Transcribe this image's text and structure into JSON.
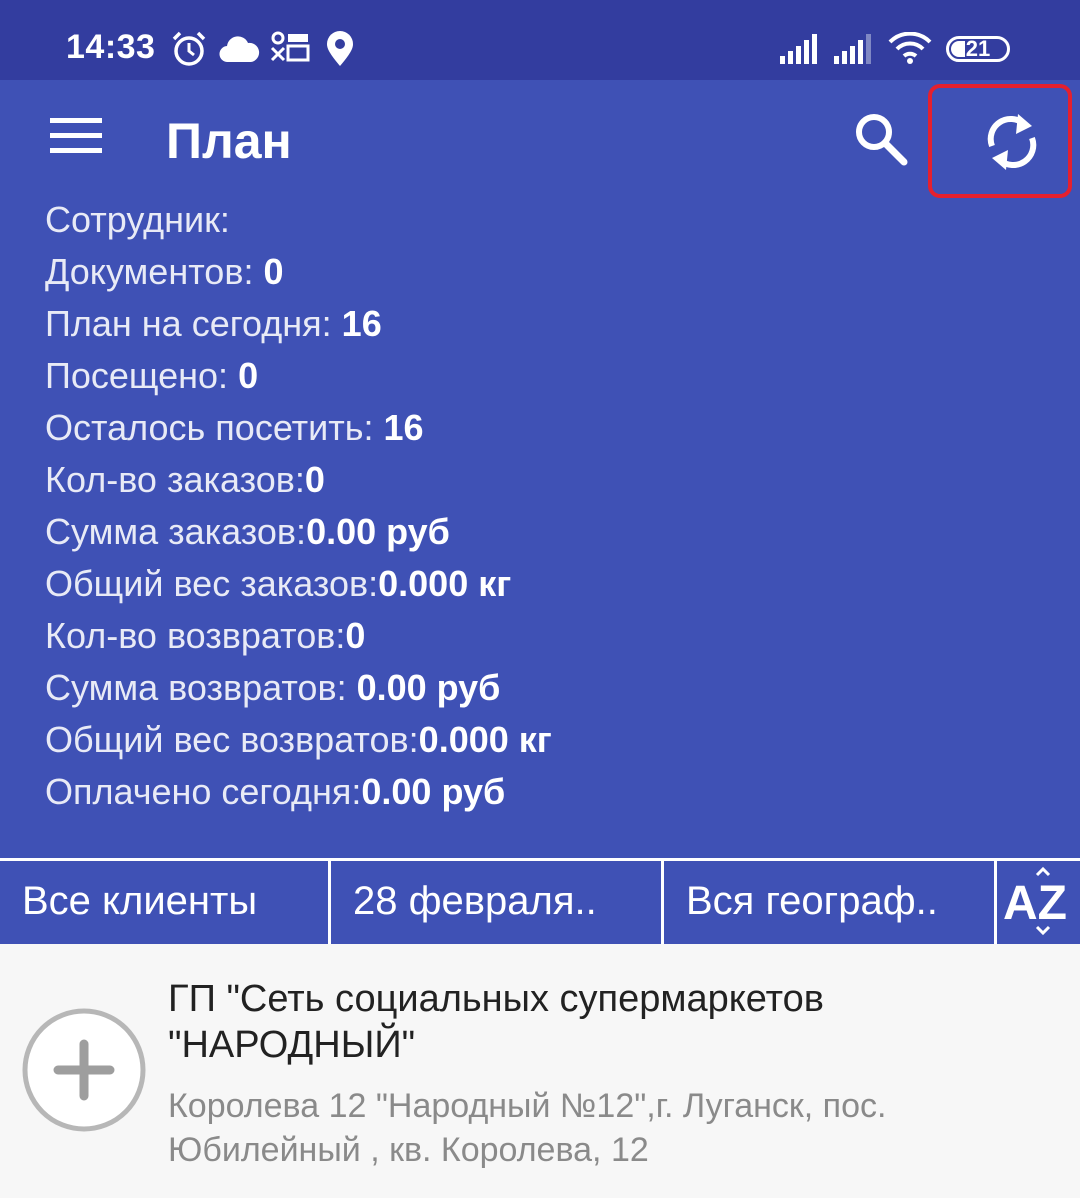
{
  "status_bar": {
    "time": "14:33",
    "battery": "21",
    "icons": [
      "alarm-icon",
      "cloud-icon",
      "notification-icon",
      "location-icon",
      "signal-icon",
      "signal-icon-2",
      "wifi-icon",
      "battery-icon"
    ]
  },
  "appbar": {
    "title": "План",
    "menu_icon": "hamburger-menu-icon",
    "search_icon": "search-icon",
    "sync_icon": "sync-icon"
  },
  "stats": [
    {
      "label": "Сотрудник:",
      "value": ""
    },
    {
      "label": "Документов: ",
      "value": "0"
    },
    {
      "label": "План на сегодня: ",
      "value": "16"
    },
    {
      "label": "Посещено: ",
      "value": "0"
    },
    {
      "label": "Осталось посетить: ",
      "value": "16"
    },
    {
      "label": "Кол-во заказов:",
      "value": "0"
    },
    {
      "label": "Сумма заказов:",
      "value": "0.00 руб"
    },
    {
      "label": "Общий вес заказов:",
      "value": "0.000 кг"
    },
    {
      "label": "Кол-во возвратов:",
      "value": "0"
    },
    {
      "label": "Сумма возвратов: ",
      "value": "0.00 руб"
    },
    {
      "label": "Общий вес возвратов:",
      "value": "0.000 кг"
    },
    {
      "label": "Оплачено сегодня:",
      "value": "0.00 руб"
    }
  ],
  "filters": {
    "clients": "Все клиенты",
    "date": "28 февраля..",
    "geography": "Вся географ..",
    "sort_label": "AZ"
  },
  "client": {
    "name": "ГП \"Сеть социальных супермаркетов \"НАРОДНЫЙ\"",
    "address": "Королева 12 \"Народный №12\",г. Луганск, пос. Юбилейный , кв. Королева, 12"
  },
  "colors": {
    "primary": "#3f51b5",
    "status_bar": "#333d9f",
    "highlight": "#e5202e"
  }
}
